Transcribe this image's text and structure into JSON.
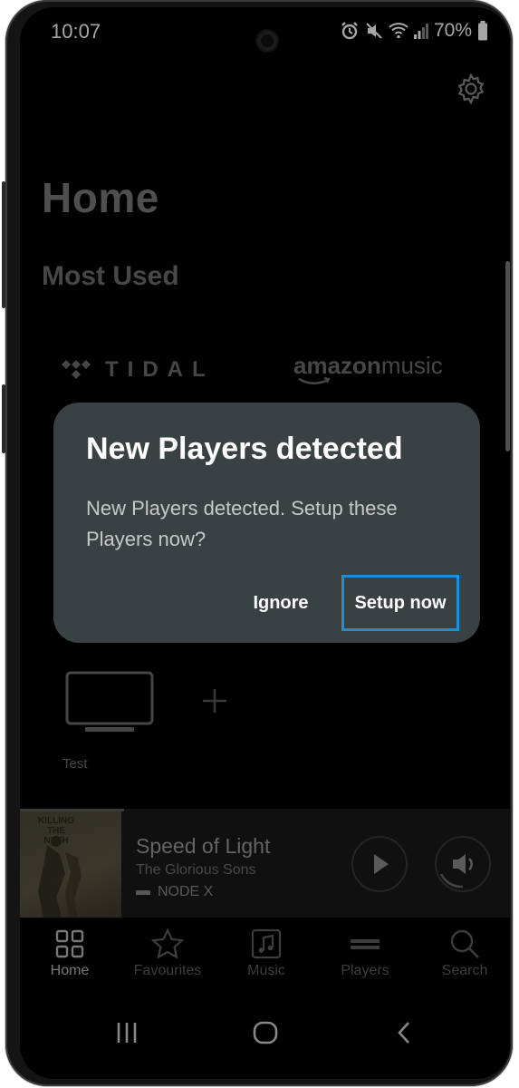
{
  "status_bar": {
    "time": "10:07",
    "battery": "70%",
    "icons": [
      "alarm-icon",
      "mute-icon",
      "wifi-icon",
      "signal-icon",
      "battery-icon"
    ]
  },
  "header": {
    "settings_icon": "gear-icon",
    "title": "Home"
  },
  "most_used": {
    "title": "Most Used",
    "services": [
      {
        "name": "TIDAL",
        "icon": "tidal-logo-icon"
      },
      {
        "name_bold": "amazon",
        "name_light": "music",
        "icon": "amazon-music-logo-icon"
      }
    ]
  },
  "players": {
    "items": [
      {
        "label": "Test",
        "icon": "tv-player-icon"
      }
    ],
    "add_icon": "plus-icon"
  },
  "now_playing": {
    "title": "Speed of Light",
    "artist": "The Glorious Sons",
    "device": "NODE X",
    "album_text": "KILLING THE NYTH",
    "play_icon": "play-icon",
    "volume_icon": "volume-icon"
  },
  "bottom_nav": {
    "items": [
      {
        "label": "Home",
        "icon": "home-grid-icon",
        "active": true
      },
      {
        "label": "Favourites",
        "icon": "star-icon",
        "active": false
      },
      {
        "label": "Music",
        "icon": "music-note-icon",
        "active": false
      },
      {
        "label": "Players",
        "icon": "players-icon",
        "active": false
      },
      {
        "label": "Search",
        "icon": "search-icon",
        "active": false
      }
    ]
  },
  "system_nav": {
    "icons": [
      "recents-icon",
      "home-circle-icon",
      "back-icon"
    ]
  },
  "dialog": {
    "title": "New Players detected",
    "message": "New Players detected. Setup these Players now?",
    "ignore_label": "Ignore",
    "setup_label": "Setup now",
    "highlight_color": "#1d8fd6"
  }
}
